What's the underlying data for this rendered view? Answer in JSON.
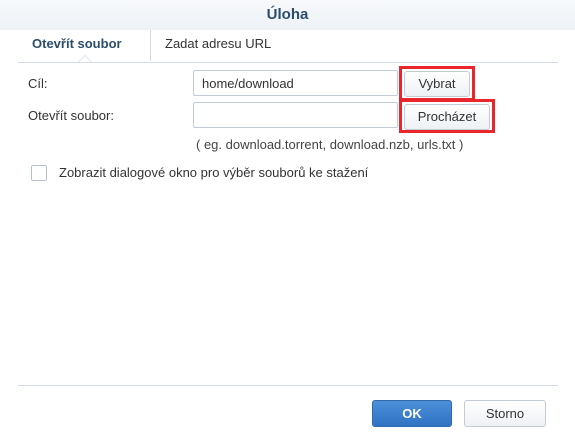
{
  "window": {
    "title": "Úloha"
  },
  "tabs": [
    {
      "label": "Otevřít soubor",
      "active": true
    },
    {
      "label": "Zadat adresu URL",
      "active": false
    }
  ],
  "form": {
    "destination_label": "Cíl:",
    "destination_value": "home/download",
    "select_button": "Vybrat",
    "open_file_label": "Otevřít soubor:",
    "open_file_value": "",
    "browse_button": "Procházet",
    "hint": "( eg. download.torrent, download.nzb, urls.txt )",
    "show_dialog_label": "Zobrazit dialogové okno pro výběr souborů ke stažení",
    "show_dialog_checked": false
  },
  "footer": {
    "ok_label": "OK",
    "cancel_label": "Storno"
  },
  "colors": {
    "title": "#2b4d6c",
    "primary_button": "#2f73c4",
    "highlight": "#e8262b"
  }
}
